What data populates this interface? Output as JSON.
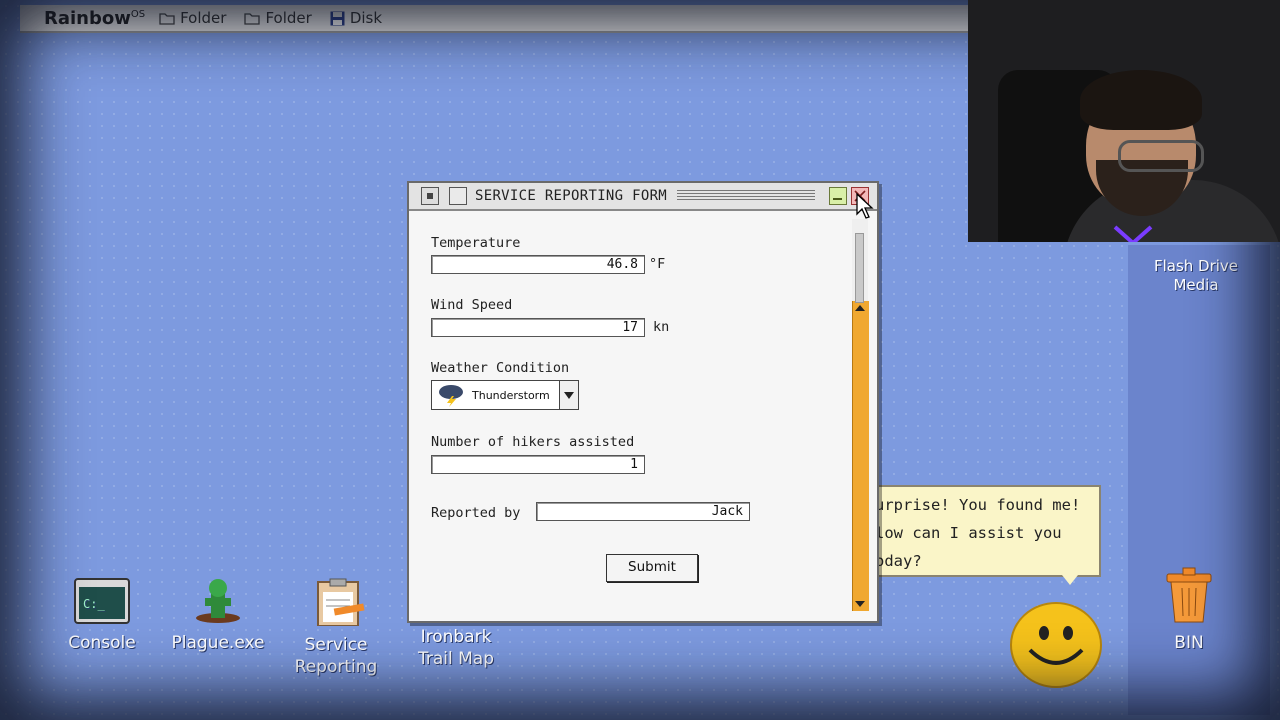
{
  "menubar": {
    "logo": "Rainbow",
    "logo_sup": "OS",
    "items": [
      {
        "label": "Folder",
        "icon": "folder-icon"
      },
      {
        "label": "Folder",
        "icon": "folder-icon"
      },
      {
        "label": "Disk",
        "icon": "disk-icon"
      }
    ]
  },
  "desktop": {
    "icons": [
      {
        "label": "Console",
        "icon": "console-icon"
      },
      {
        "label": "Plague.exe",
        "icon": "plague-icon"
      },
      {
        "label_line1": "Service",
        "label_line2": "Reporting",
        "icon": "clipboard-icon"
      },
      {
        "label_line1": "Ironbark",
        "label_line2": "Trail Map",
        "icon": "map-icon"
      },
      {
        "label": "BIN",
        "icon": "trash-icon"
      }
    ],
    "flash_drive": {
      "line1": "Flash Drive",
      "line2": "Media",
      "icon": "flash-drive-icon"
    }
  },
  "window": {
    "title": "SERVICE REPORTING FORM",
    "fields": {
      "temperature": {
        "label": "Temperature",
        "value": "46.8",
        "unit": "°F"
      },
      "wind_speed": {
        "label": "Wind Speed",
        "value": "17",
        "unit": "kn"
      },
      "weather": {
        "label": "Weather Condition",
        "value": "Thunderstorm",
        "icon": "thunderstorm-icon"
      },
      "hikers": {
        "label": "Number of hikers assisted",
        "value": "1"
      },
      "reported_by": {
        "label": "Reported by",
        "value": "Jack"
      }
    },
    "submit_label": "Submit"
  },
  "assistant": {
    "line1": "urprise! You found me!",
    "line2": "low can I assist you",
    "line3": "oday?",
    "icon": "smiley-icon"
  },
  "colors": {
    "desktop": "#7d9adf",
    "scroll_accent": "#f0a830",
    "bubble": "#faf5c8"
  }
}
